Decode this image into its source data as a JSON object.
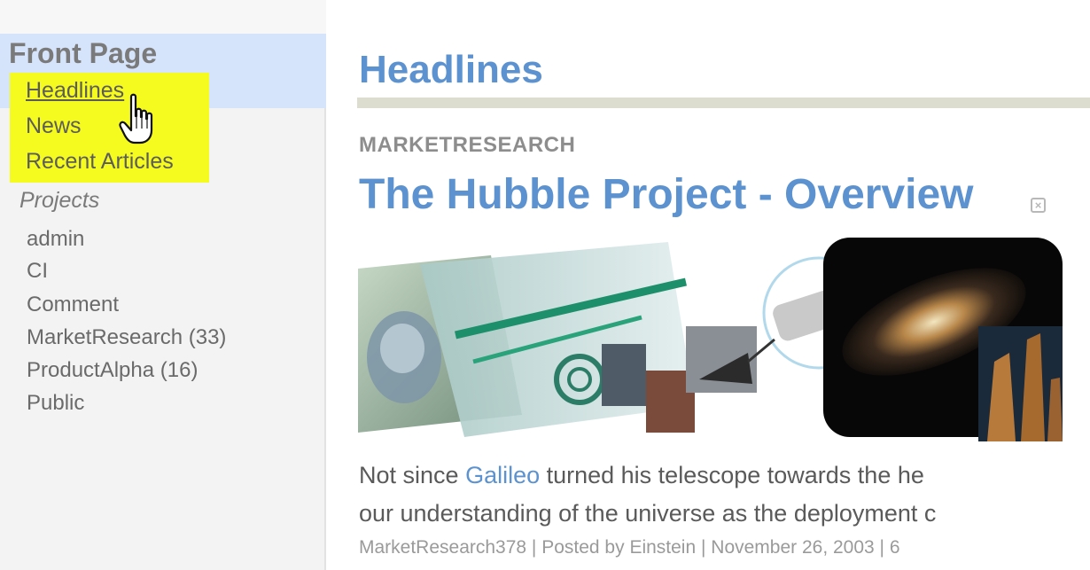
{
  "sidebar": {
    "section_title": "Front Page",
    "nav_items": [
      {
        "label": "Headlines",
        "active": true
      },
      {
        "label": "News",
        "active": false
      },
      {
        "label": "Recent Articles",
        "active": false
      }
    ],
    "projects_heading": "Projects",
    "projects": [
      {
        "label": "admin"
      },
      {
        "label": "CI"
      },
      {
        "label": "Comment"
      },
      {
        "label": "MarketResearch (33)"
      },
      {
        "label": "ProductAlpha (16)"
      },
      {
        "label": "Public"
      }
    ]
  },
  "main": {
    "page_title": "Headlines",
    "section_label": "MARKETRESEARCH",
    "article": {
      "title": "The Hubble Project - Overview",
      "body_line1_before": "Not since ",
      "body_link": "Galileo",
      "body_line1_after": " turned his telescope towards the he",
      "body_line2": "our understanding of the universe as the deployment c",
      "meta": "MarketResearch378 | Posted by Einstein | November 26, 2003 | 6"
    }
  },
  "colors": {
    "accent_blue": "#5b92cf",
    "highlight_yellow": "#f5fb1e",
    "selection_blue": "#d6e4fb"
  },
  "icons": {
    "cursor": "hand-pointer-icon",
    "close": "close-icon"
  }
}
